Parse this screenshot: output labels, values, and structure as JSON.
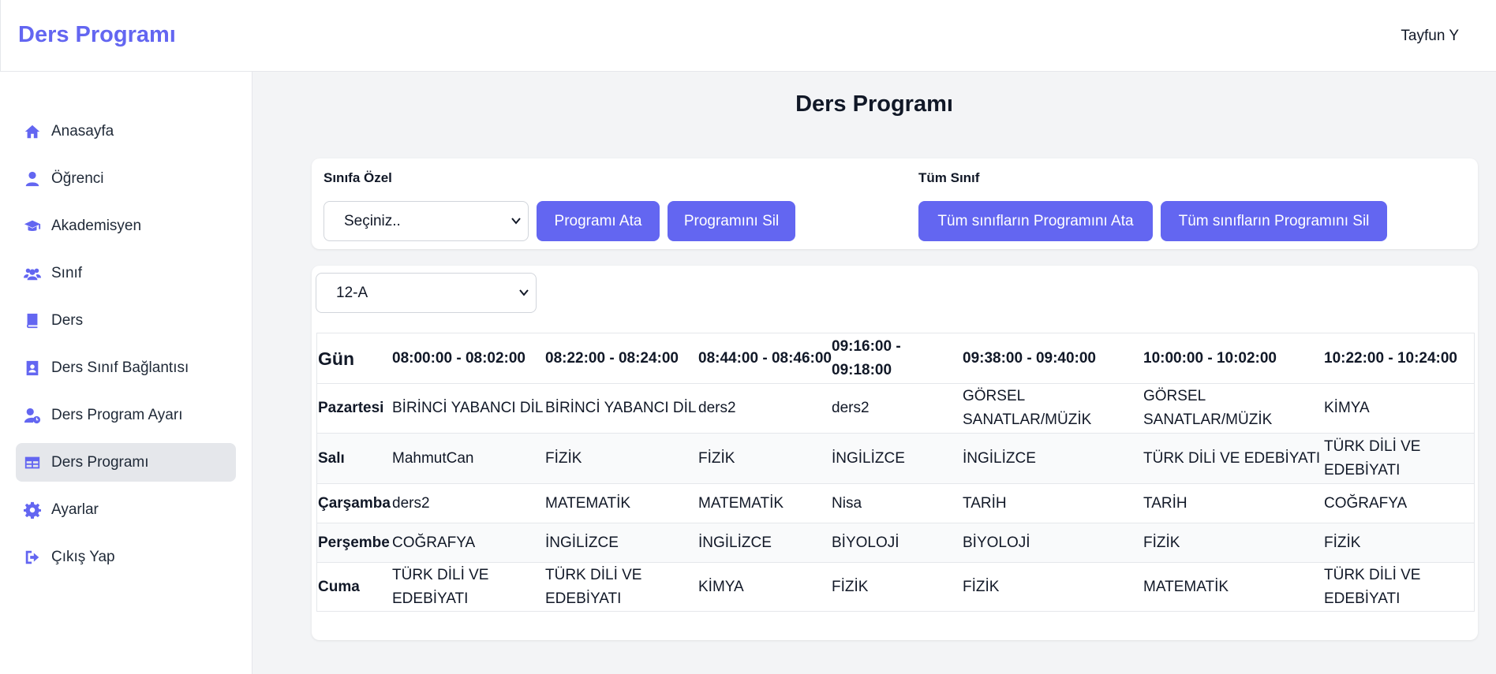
{
  "app": {
    "title": "Ders Programı",
    "user": "Tayfun Y"
  },
  "sidebar": {
    "items": [
      {
        "label": "Anasayfa",
        "icon": "home-icon"
      },
      {
        "label": "Öğrenci",
        "icon": "user-icon"
      },
      {
        "label": "Akademisyen",
        "icon": "graduation-cap-icon"
      },
      {
        "label": "Sınıf",
        "icon": "users-icon"
      },
      {
        "label": "Ders",
        "icon": "book-icon"
      },
      {
        "label": "Ders Sınıf Bağlantısı",
        "icon": "contact-book-icon"
      },
      {
        "label": "Ders Program Ayarı",
        "icon": "user-clock-icon"
      },
      {
        "label": "Ders Programı",
        "icon": "table-icon",
        "active": true
      },
      {
        "label": "Ayarlar",
        "icon": "gear-icon"
      },
      {
        "label": "Çıkış Yap",
        "icon": "sign-out-icon"
      }
    ]
  },
  "page": {
    "title": "Ders Programı"
  },
  "class_specific": {
    "label": "Sınıfa Özel",
    "select_value": "Seçiniz..",
    "assign_button": "Programı Ata",
    "delete_button": "Programını Sil"
  },
  "all_classes": {
    "label": "Tüm Sınıf",
    "assign_button": "Tüm sınıfların Programını Ata",
    "delete_button": "Tüm sınıfların Programını Sil"
  },
  "schedule": {
    "class_select": "12-A",
    "headers": [
      "Gün",
      "08:00:00 - 08:02:00",
      "08:22:00 - 08:24:00",
      "08:44:00 - 08:46:00",
      "09:16:00 - 09:18:00",
      "09:38:00 - 09:40:00",
      "10:00:00 - 10:02:00",
      "10:22:00 - 10:24:00"
    ],
    "rows": [
      {
        "day": "Pazartesi",
        "cells": [
          "BİRİNCİ YABANCI DİL",
          "BİRİNCİ YABANCI DİL",
          "ders2",
          "ders2",
          "GÖRSEL SANATLAR/MÜZİK",
          "GÖRSEL SANATLAR/MÜZİK",
          "KİMYA"
        ]
      },
      {
        "day": "Salı",
        "cells": [
          "MahmutCan",
          "FİZİK",
          "FİZİK",
          "İNGİLİZCE",
          "İNGİLİZCE",
          "TÜRK DİLİ VE EDEBİYATI",
          "TÜRK DİLİ VE EDEBİYATI"
        ]
      },
      {
        "day": "Çarşamba",
        "cells": [
          "ders2",
          "MATEMATİK",
          "MATEMATİK",
          "Nisa",
          "TARİH",
          "TARİH",
          "COĞRAFYA"
        ]
      },
      {
        "day": "Perşembe",
        "cells": [
          "COĞRAFYA",
          "İNGİLİZCE",
          "İNGİLİZCE",
          "BİYOLOJİ",
          "BİYOLOJİ",
          "FİZİK",
          "FİZİK"
        ]
      },
      {
        "day": "Cuma",
        "cells": [
          "TÜRK DİLİ VE EDEBİYATI",
          "TÜRK DİLİ VE EDEBİYATI",
          "KİMYA",
          "FİZİK",
          "FİZİK",
          "MATEMATİK",
          "TÜRK DİLİ VE EDEBİYATI"
        ]
      }
    ]
  },
  "colors": {
    "accent": "#6366f1",
    "background": "#f3f4f6",
    "active_item": "#e5e7eb"
  }
}
